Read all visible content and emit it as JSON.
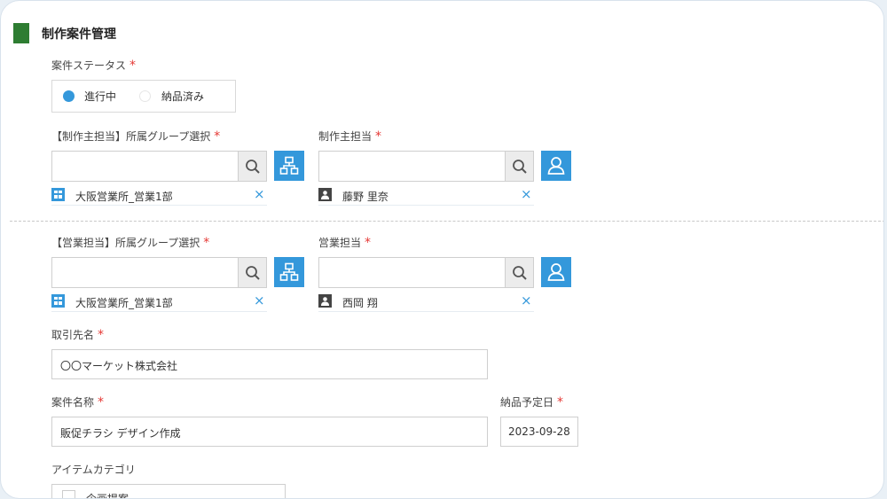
{
  "section": {
    "title": "制作案件管理"
  },
  "status": {
    "label": "案件ステータス",
    "required": "*",
    "options": [
      {
        "label": "進行中",
        "selected": true
      },
      {
        "label": "納品済み",
        "selected": false
      }
    ]
  },
  "production": {
    "group": {
      "label": "【制作主担当】所属グループ選択",
      "required": "*",
      "value": "",
      "chip": "大阪営業所_営業1部"
    },
    "owner": {
      "label": "制作主担当",
      "required": "*",
      "value": "",
      "chip": "藤野 里奈"
    }
  },
  "sales": {
    "group": {
      "label": "【営業担当】所属グループ選択",
      "required": "*",
      "value": "",
      "chip": "大阪営業所_営業1部"
    },
    "owner": {
      "label": "営業担当",
      "required": "*",
      "value": "",
      "chip": "西岡 翔"
    }
  },
  "client": {
    "label": "取引先名",
    "required": "*",
    "value": "〇〇マーケット株式会社"
  },
  "project": {
    "label": "案件名称",
    "required": "*",
    "value": "販促チラシ デザイン作成"
  },
  "delivery": {
    "label": "納品予定日",
    "required": "*",
    "value": "2023-09-28"
  },
  "category": {
    "label": "アイテムカテゴリ",
    "options": [
      {
        "label": "企画提案",
        "checked": false
      }
    ]
  },
  "remove_glyph": "×",
  "colors": {
    "accent": "#3498db",
    "title_bar": "#2e7d32",
    "required": "#e53935"
  }
}
